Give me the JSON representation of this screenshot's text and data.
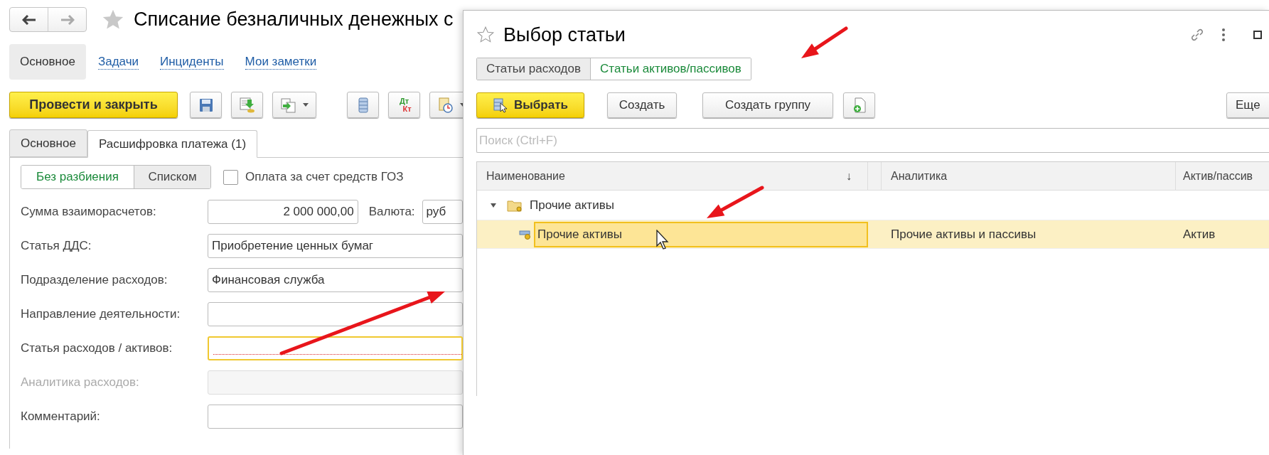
{
  "document": {
    "title": "Списание безналичных денежных с"
  },
  "sections": [
    {
      "label": "Основное",
      "selected": true
    },
    {
      "label": "Задачи",
      "selected": false
    },
    {
      "label": "Инциденты",
      "selected": false
    },
    {
      "label": "Мои заметки",
      "selected": false
    }
  ],
  "toolbar": {
    "primary": "Провести и закрыть",
    "buttons": [
      {
        "kind": "save",
        "dropdown": false
      },
      {
        "kind": "post",
        "dropdown": false
      },
      {
        "kind": "copy",
        "dropdown": true
      },
      {
        "kind": "list",
        "dropdown": false
      },
      {
        "kind": "dtkt",
        "top": "Дт",
        "bottom": "Кт",
        "dropdown": false
      },
      {
        "kind": "report",
        "dropdown": true
      }
    ]
  },
  "tabs": [
    {
      "label": "Основное",
      "selected": false
    },
    {
      "label": "Расшифровка платежа (1)",
      "selected": true
    }
  ],
  "split_modes": [
    {
      "label": "Без разбиения",
      "selected": true
    },
    {
      "label": "Списком",
      "selected": false
    }
  ],
  "goz": {
    "label": "Оплата за счет средств ГОЗ",
    "checked": false
  },
  "fields": [
    {
      "kind": "amount",
      "label": "Сумма взаиморасчетов:",
      "value": "2 000 000,00",
      "currency_label": "Валюта:",
      "currency_value": "руб",
      "focused": false,
      "disabled": false
    },
    {
      "kind": "text",
      "label": "Статья ДДС:",
      "value": "Приобретение ценных бумаг",
      "focused": false,
      "disabled": false
    },
    {
      "kind": "text",
      "label": "Подразделение расходов:",
      "value": "Финансовая служба",
      "focused": false,
      "disabled": false
    },
    {
      "kind": "text",
      "label": "Направление деятельности:",
      "focused": false,
      "disabled": false
    },
    {
      "kind": "text",
      "label": "Статья расходов / активов:",
      "focused": true,
      "disabled": false
    },
    {
      "kind": "text",
      "label": "Аналитика расходов:",
      "focused": false,
      "disabled": true
    },
    {
      "kind": "text",
      "label": "Комментарий:",
      "focused": false,
      "disabled": false
    }
  ],
  "dialog": {
    "title": "Выбор статьи",
    "tabs": [
      {
        "label": "Статьи расходов",
        "selected": false
      },
      {
        "label": "Статьи активов/пассивов",
        "selected": true
      }
    ],
    "toolbar": {
      "select": "Выбрать",
      "create": "Создать",
      "create_group": "Создать группу",
      "more": "Еще"
    },
    "search": {
      "placeholder": "Поиск (Ctrl+F)"
    },
    "table": {
      "columns": [
        {
          "label": "Наименование",
          "sort": "↓"
        },
        {
          "label": "Аналитика"
        },
        {
          "label": "Актив/пассив"
        }
      ],
      "rows": [
        {
          "kind": "group",
          "name": "Прочие активы",
          "expanded": true,
          "selected": false,
          "children": [
            {
              "kind": "item",
              "name": "Прочие активы",
              "analytics": "Прочие активы и пассивы",
              "type": "Актив",
              "selected": true
            }
          ]
        }
      ]
    }
  }
}
